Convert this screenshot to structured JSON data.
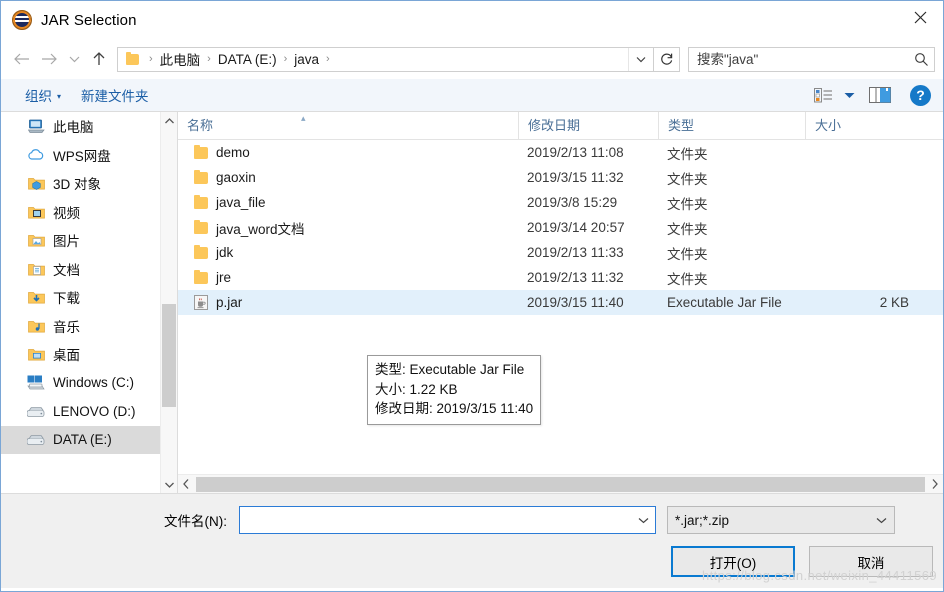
{
  "window": {
    "title": "JAR Selection",
    "app_icon": "java-icon",
    "close_label": "✕"
  },
  "nav": {
    "back": "←",
    "forward": "→",
    "recent": "⌄",
    "up": "↑",
    "refresh": "↻",
    "dropdown": "⌄"
  },
  "address": {
    "folder_icon": "folder-icon",
    "crumbs": [
      "此电脑",
      "DATA (E:)",
      "java"
    ],
    "separator": "›"
  },
  "search": {
    "placeholder": "搜索\"java\"",
    "value": "",
    "icon": "search-icon"
  },
  "toolbar": {
    "organize_label": "组织",
    "caret": "▾",
    "new_folder_label": "新建文件夹",
    "view_icon": "view-options-icon",
    "view_caret": "▾",
    "preview_icon": "preview-pane-icon",
    "help_label": "?"
  },
  "sidebar": {
    "items": [
      {
        "label": "此电脑",
        "icon": "this-pc-icon",
        "selected": false
      },
      {
        "label": "WPS网盘",
        "icon": "cloud-icon",
        "selected": false
      },
      {
        "label": "3D 对象",
        "icon": "folder-3d-icon",
        "selected": false
      },
      {
        "label": "视频",
        "icon": "folder-videos-icon",
        "selected": false
      },
      {
        "label": "图片",
        "icon": "folder-pictures-icon",
        "selected": false
      },
      {
        "label": "文档",
        "icon": "folder-documents-icon",
        "selected": false
      },
      {
        "label": "下载",
        "icon": "folder-downloads-icon",
        "selected": false
      },
      {
        "label": "音乐",
        "icon": "folder-music-icon",
        "selected": false
      },
      {
        "label": "桌面",
        "icon": "folder-desktop-icon",
        "selected": false
      },
      {
        "label": "Windows (C:)",
        "icon": "drive-windows-icon",
        "selected": false
      },
      {
        "label": "LENOVO (D:)",
        "icon": "drive-icon",
        "selected": false
      },
      {
        "label": "DATA (E:)",
        "icon": "drive-icon",
        "selected": true
      }
    ],
    "scroll_up": "⌃",
    "scroll_down": "⌄"
  },
  "filelist": {
    "columns": [
      "名称",
      "修改日期",
      "类型",
      "大小"
    ],
    "sort_indicator": "▴",
    "rows": [
      {
        "name": "demo",
        "date": "2019/2/13 11:08",
        "type": "文件夹",
        "size": "",
        "icon": "folder-icon",
        "selected": false
      },
      {
        "name": "gaoxin",
        "date": "2019/3/15 11:32",
        "type": "文件夹",
        "size": "",
        "icon": "folder-icon",
        "selected": false
      },
      {
        "name": "java_file",
        "date": "2019/3/8 15:29",
        "type": "文件夹",
        "size": "",
        "icon": "folder-icon",
        "selected": false
      },
      {
        "name": "java_word文档",
        "date": "2019/3/14 20:57",
        "type": "文件夹",
        "size": "",
        "icon": "folder-icon",
        "selected": false
      },
      {
        "name": "jdk",
        "date": "2019/2/13 11:33",
        "type": "文件夹",
        "size": "",
        "icon": "folder-icon",
        "selected": false
      },
      {
        "name": "jre",
        "date": "2019/2/13 11:32",
        "type": "文件夹",
        "size": "",
        "icon": "folder-icon",
        "selected": false
      },
      {
        "name": "p.jar",
        "date": "2019/3/15 11:40",
        "type": "Executable Jar File",
        "size": "2 KB",
        "icon": "jar-file-icon",
        "selected": true
      }
    ],
    "scroll_left": "‹",
    "scroll_right": "›"
  },
  "tooltip": {
    "line1": "类型: Executable Jar File",
    "line2": "大小: 1.22 KB",
    "line3": "修改日期: 2019/3/15 11:40"
  },
  "footer": {
    "filename_label": "文件名(N):",
    "filename_value": "",
    "filename_dropdown": "⌄",
    "filter_value": "*.jar;*.zip",
    "filter_dropdown": "⌄",
    "open_button": "打开(O)",
    "cancel_button": "取消"
  },
  "watermark": "https://blog.csdn.net/weixin_44411569",
  "colors": {
    "accent": "#0a7ad1",
    "selection": "#e2f0fb",
    "folder": "#fcc75a",
    "link": "#1b5ea6"
  }
}
